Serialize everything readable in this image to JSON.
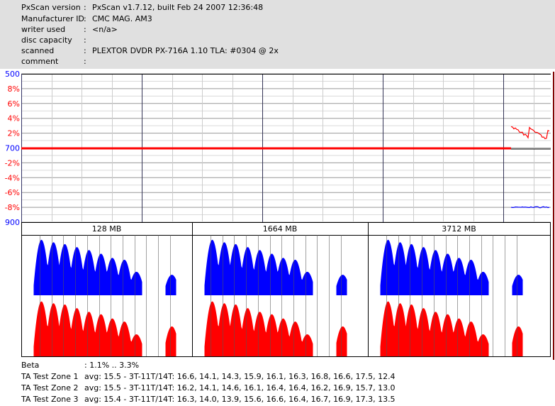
{
  "header": {
    "rows": [
      {
        "key": "PxScan version",
        "value": "PxScan v1.7.12, built Feb 24 2007 12:36:48"
      },
      {
        "key": "Manufacturer ID",
        "value": "CMC MAG. AM3"
      },
      {
        "key": "writer used",
        "value": "<n/a>"
      },
      {
        "key": "disc capacity",
        "value": ""
      },
      {
        "key": "scanned",
        "value": "PLEXTOR DVDR PX-716A 1.10 TLA: #0304 @ 2x"
      },
      {
        "key": "comment",
        "value": ""
      }
    ],
    "separator": ":"
  },
  "chart_data": [
    {
      "type": "line",
      "y_ticks": [
        {
          "label": "500",
          "color": "#0000ff"
        },
        {
          "label": "8%",
          "color": "#ff0000"
        },
        {
          "label": "6%",
          "color": "#ff0000"
        },
        {
          "label": "4%",
          "color": "#ff0000"
        },
        {
          "label": "2%",
          "color": "#ff0000"
        },
        {
          "label": "700",
          "color": "#0000ff"
        },
        {
          "label": "-2%",
          "color": "#ff0000"
        },
        {
          "label": "-4%",
          "color": "#ff0000"
        },
        {
          "label": "-6%",
          "color": "#ff0000"
        },
        {
          "label": "-8%",
          "color": "#ff0000"
        },
        {
          "label": "900",
          "color": "#0000ff"
        }
      ],
      "ylim_percent": [
        -10,
        10
      ],
      "grid": true,
      "series": [
        {
          "color": "#ff0000",
          "segments": [
            {
              "from": 0,
              "to": 0.925,
              "value_percent": 0
            },
            {
              "from": 0.925,
              "to": 1,
              "value_percent_range": [
                1.2,
                3.0
              ]
            }
          ]
        },
        {
          "color": "#0000ff",
          "segments": [
            {
              "from": 0.925,
              "to": 1,
              "value_percent": -7.9
            }
          ]
        }
      ]
    },
    {
      "type": "area",
      "panels": [
        {
          "label": "128 MB"
        },
        {
          "label": "1664 MB"
        },
        {
          "label": "3712 MB"
        }
      ],
      "blue_color": "#0000ff",
      "red_color": "#ff0000",
      "blue_peaks": [
        0.92,
        0.88,
        0.85,
        0.8,
        0.75,
        0.69,
        0.62,
        0.59,
        0.39,
        0,
        0,
        0.34
      ],
      "red_peaks": [
        0.9,
        0.87,
        0.85,
        0.79,
        0.73,
        0.69,
        0.62,
        0.57,
        0.36,
        0,
        0,
        0.49
      ]
    }
  ],
  "footer": {
    "beta": {
      "key": "Beta",
      "value": ": 1.1% .. 3.3%"
    },
    "zones": [
      {
        "key": "TA Test Zone 1",
        "value": "avg: 15.5 - 3T-11T/14T: 16.6, 14.1, 14.3, 15.9, 16.1, 16.3, 16.8, 16.6, 17.5, 12.4"
      },
      {
        "key": "TA Test Zone 2",
        "value": "avg: 15.5 - 3T-11T/14T: 16.2, 14.1, 14.6, 16.1, 16.4, 16.4, 16.2, 16.9, 15.7, 13.0"
      },
      {
        "key": "TA Test Zone 3",
        "value": "avg: 15.4 - 3T-11T/14T: 16.3, 14.0, 13.9, 15.6, 16.6, 16.4, 16.7, 16.9, 17.3, 13.5"
      }
    ]
  }
}
